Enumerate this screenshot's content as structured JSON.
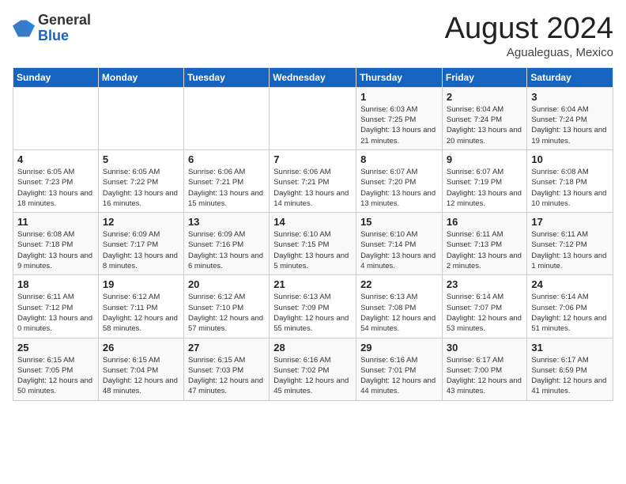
{
  "logo": {
    "general": "General",
    "blue": "Blue"
  },
  "title": {
    "month_year": "August 2024",
    "location": "Agualeguas, Mexico"
  },
  "weekdays": [
    "Sunday",
    "Monday",
    "Tuesday",
    "Wednesday",
    "Thursday",
    "Friday",
    "Saturday"
  ],
  "weeks": [
    [
      {
        "day": "",
        "info": ""
      },
      {
        "day": "",
        "info": ""
      },
      {
        "day": "",
        "info": ""
      },
      {
        "day": "",
        "info": ""
      },
      {
        "day": "1",
        "info": "Sunrise: 6:03 AM\nSunset: 7:25 PM\nDaylight: 13 hours and 21 minutes."
      },
      {
        "day": "2",
        "info": "Sunrise: 6:04 AM\nSunset: 7:24 PM\nDaylight: 13 hours and 20 minutes."
      },
      {
        "day": "3",
        "info": "Sunrise: 6:04 AM\nSunset: 7:24 PM\nDaylight: 13 hours and 19 minutes."
      }
    ],
    [
      {
        "day": "4",
        "info": "Sunrise: 6:05 AM\nSunset: 7:23 PM\nDaylight: 13 hours and 18 minutes."
      },
      {
        "day": "5",
        "info": "Sunrise: 6:05 AM\nSunset: 7:22 PM\nDaylight: 13 hours and 16 minutes."
      },
      {
        "day": "6",
        "info": "Sunrise: 6:06 AM\nSunset: 7:21 PM\nDaylight: 13 hours and 15 minutes."
      },
      {
        "day": "7",
        "info": "Sunrise: 6:06 AM\nSunset: 7:21 PM\nDaylight: 13 hours and 14 minutes."
      },
      {
        "day": "8",
        "info": "Sunrise: 6:07 AM\nSunset: 7:20 PM\nDaylight: 13 hours and 13 minutes."
      },
      {
        "day": "9",
        "info": "Sunrise: 6:07 AM\nSunset: 7:19 PM\nDaylight: 13 hours and 12 minutes."
      },
      {
        "day": "10",
        "info": "Sunrise: 6:08 AM\nSunset: 7:18 PM\nDaylight: 13 hours and 10 minutes."
      }
    ],
    [
      {
        "day": "11",
        "info": "Sunrise: 6:08 AM\nSunset: 7:18 PM\nDaylight: 13 hours and 9 minutes."
      },
      {
        "day": "12",
        "info": "Sunrise: 6:09 AM\nSunset: 7:17 PM\nDaylight: 13 hours and 8 minutes."
      },
      {
        "day": "13",
        "info": "Sunrise: 6:09 AM\nSunset: 7:16 PM\nDaylight: 13 hours and 6 minutes."
      },
      {
        "day": "14",
        "info": "Sunrise: 6:10 AM\nSunset: 7:15 PM\nDaylight: 13 hours and 5 minutes."
      },
      {
        "day": "15",
        "info": "Sunrise: 6:10 AM\nSunset: 7:14 PM\nDaylight: 13 hours and 4 minutes."
      },
      {
        "day": "16",
        "info": "Sunrise: 6:11 AM\nSunset: 7:13 PM\nDaylight: 13 hours and 2 minutes."
      },
      {
        "day": "17",
        "info": "Sunrise: 6:11 AM\nSunset: 7:12 PM\nDaylight: 13 hours and 1 minute."
      }
    ],
    [
      {
        "day": "18",
        "info": "Sunrise: 6:11 AM\nSunset: 7:12 PM\nDaylight: 13 hours and 0 minutes."
      },
      {
        "day": "19",
        "info": "Sunrise: 6:12 AM\nSunset: 7:11 PM\nDaylight: 12 hours and 58 minutes."
      },
      {
        "day": "20",
        "info": "Sunrise: 6:12 AM\nSunset: 7:10 PM\nDaylight: 12 hours and 57 minutes."
      },
      {
        "day": "21",
        "info": "Sunrise: 6:13 AM\nSunset: 7:09 PM\nDaylight: 12 hours and 55 minutes."
      },
      {
        "day": "22",
        "info": "Sunrise: 6:13 AM\nSunset: 7:08 PM\nDaylight: 12 hours and 54 minutes."
      },
      {
        "day": "23",
        "info": "Sunrise: 6:14 AM\nSunset: 7:07 PM\nDaylight: 12 hours and 53 minutes."
      },
      {
        "day": "24",
        "info": "Sunrise: 6:14 AM\nSunset: 7:06 PM\nDaylight: 12 hours and 51 minutes."
      }
    ],
    [
      {
        "day": "25",
        "info": "Sunrise: 6:15 AM\nSunset: 7:05 PM\nDaylight: 12 hours and 50 minutes."
      },
      {
        "day": "26",
        "info": "Sunrise: 6:15 AM\nSunset: 7:04 PM\nDaylight: 12 hours and 48 minutes."
      },
      {
        "day": "27",
        "info": "Sunrise: 6:15 AM\nSunset: 7:03 PM\nDaylight: 12 hours and 47 minutes."
      },
      {
        "day": "28",
        "info": "Sunrise: 6:16 AM\nSunset: 7:02 PM\nDaylight: 12 hours and 45 minutes."
      },
      {
        "day": "29",
        "info": "Sunrise: 6:16 AM\nSunset: 7:01 PM\nDaylight: 12 hours and 44 minutes."
      },
      {
        "day": "30",
        "info": "Sunrise: 6:17 AM\nSunset: 7:00 PM\nDaylight: 12 hours and 43 minutes."
      },
      {
        "day": "31",
        "info": "Sunrise: 6:17 AM\nSunset: 6:59 PM\nDaylight: 12 hours and 41 minutes."
      }
    ]
  ]
}
